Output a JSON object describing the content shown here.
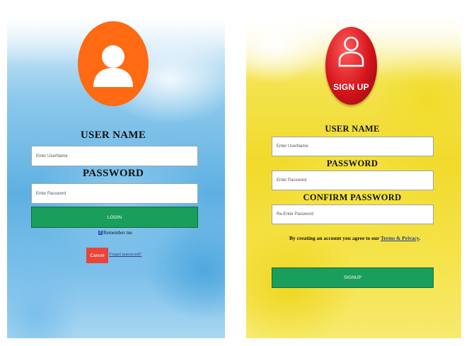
{
  "login": {
    "username_label": "USER NAME",
    "username_placeholder": "Enter UserName",
    "password_label": "PASSWORD",
    "password_placeholder": "Enter Password",
    "login_button": "LOGIN",
    "remember_label": "Remember me",
    "remember_checked": true,
    "cancel_button": "Cancel",
    "forgot_link": "Forgot password?"
  },
  "signup": {
    "badge_text": "SIGN UP",
    "username_label": "USER NAME",
    "username_placeholder": "Enter UserName",
    "password_label": "PASSWORD",
    "password_placeholder": "Enter Password",
    "confirm_label": "CONFIRM PASSWORD",
    "confirm_placeholder": "Re-Enter Password",
    "agree_prefix": "By creating an account you agree to our",
    "terms_link": "Terms & Privacy",
    "agree_suffix": ".",
    "signup_button": "SIGNUP"
  },
  "colors": {
    "login_avatar": "#ff6a13",
    "signup_badge": "#d4141a",
    "green_button": "#1a9e5c",
    "cancel_button": "#e8443b"
  },
  "icons": {
    "login_avatar": "user-icon",
    "signup_badge": "user-outline-icon"
  }
}
